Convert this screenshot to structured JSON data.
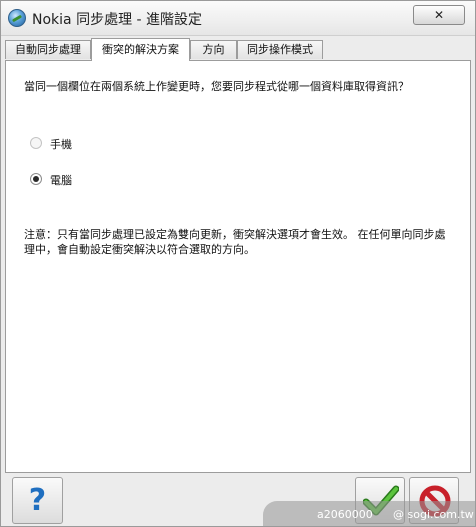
{
  "window": {
    "title": "Nokia 同步處理 - 進階設定",
    "close_label": "✕"
  },
  "tabs": [
    {
      "label": "自動同步處理",
      "active": false
    },
    {
      "label": "衝突的解決方案",
      "active": true
    },
    {
      "label": "方向",
      "active": false
    },
    {
      "label": "同步操作模式",
      "active": false
    }
  ],
  "content": {
    "question": "當同一個欄位在兩個系統上作變更時，您要同步程式從哪一個資料庫取得資訊？",
    "options": [
      {
        "label": "手機",
        "checked": false
      },
      {
        "label": "電腦",
        "checked": true
      }
    ],
    "note": "注意：只有當同步處理已設定為雙向更新，衝突解決選項才會生效。 在任何單向同步處理中，會自動設定衝突解決以符合選取的方向。"
  },
  "footer": {
    "help_icon": "?",
    "ok_icon": "checkmark-icon",
    "cancel_icon": "cancel-icon"
  },
  "watermark": {
    "left_text": "a2060000",
    "right_text": "@ sogi.com.tw"
  },
  "colors": {
    "help_blue": "#1f6fc0",
    "ok_green": "#3fa028",
    "cancel_red": "#c8202a"
  }
}
